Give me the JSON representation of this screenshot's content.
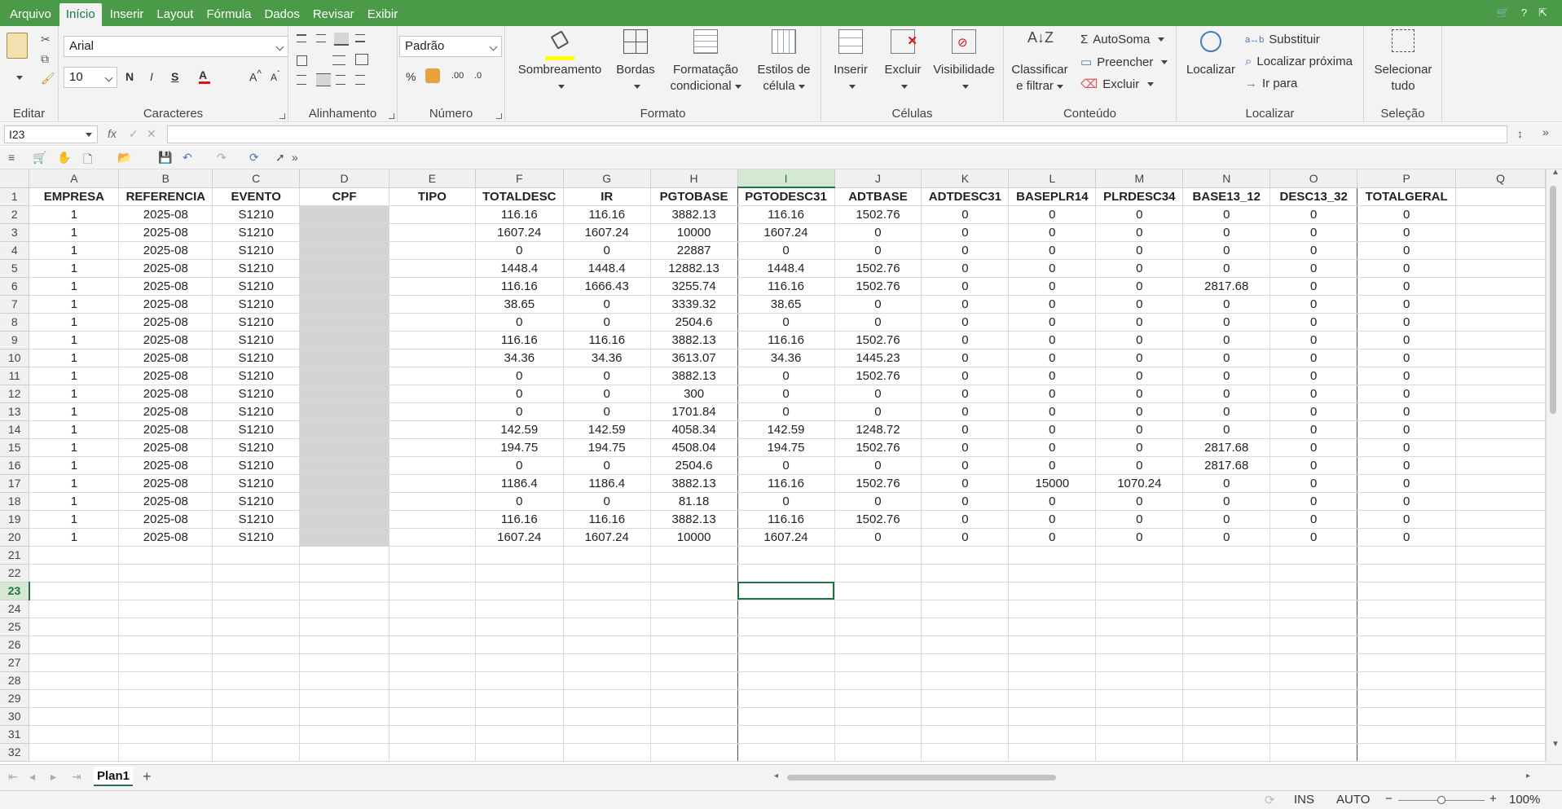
{
  "menu": {
    "tabs": [
      "Arquivo",
      "Início",
      "Inserir",
      "Layout",
      "Fórmula",
      "Dados",
      "Revisar",
      "Exibir"
    ],
    "active_tab": "Início",
    "right_icons": [
      "cart-icon",
      "help-icon",
      "restore-icon"
    ]
  },
  "ribbon": {
    "groups": {
      "editar": "Editar",
      "caracteres": "Caracteres",
      "alinhamento": "Alinhamento",
      "numero": "Número",
      "formato": "Formato",
      "celulas": "Células",
      "conteudo": "Conteúdo",
      "localizar": "Localizar",
      "selecao": "Seleção"
    },
    "font_name": "Arial",
    "font_size": "10",
    "number_format": "Padrão",
    "format_buttons": {
      "sombreamento": "Sombreamento",
      "bordas": "Bordas",
      "formatacao_1": "Formatação",
      "formatacao_2": "condicional",
      "estilos_1": "Estilos de",
      "estilos_2": "célula"
    },
    "cell_buttons": {
      "inserir": "Inserir",
      "excluir": "Excluir",
      "visibilidade": "Visibilidade"
    },
    "content": {
      "classificar_1": "Classificar",
      "classificar_2": "e filtrar",
      "autosoma": "AutoSoma",
      "preencher": "Preencher",
      "excluir": "Excluir"
    },
    "find": {
      "localizar": "Localizar",
      "substituir": "Substituir",
      "localizar_proxima": "Localizar próxima",
      "ir_para": "Ir para"
    },
    "select": {
      "line1": "Selecionar",
      "line2": "tudo"
    },
    "accent_shading": "#ffff00",
    "accent_font": "#e01010"
  },
  "formula_bar": {
    "name_box": "I23",
    "fx": "fx",
    "formula": ""
  },
  "sheet": {
    "columns": [
      "A",
      "B",
      "C",
      "D",
      "E",
      "F",
      "G",
      "H",
      "I",
      "J",
      "K",
      "L",
      "M",
      "N",
      "O",
      "P",
      "Q"
    ],
    "selected_column": "I",
    "selected_row": "23",
    "headers": [
      "EMPRESA",
      "REFERENCIA",
      "EVENTO",
      "CPF",
      "TIPO",
      "TOTALDESC",
      "IR",
      "PGTOBASE",
      "PGTODESC31",
      "ADTBASE",
      "ADTDESC31",
      "BASEPLR14",
      "PLRDESC34",
      "BASE13_12",
      "DESC13_32",
      "TOTALGERAL",
      ""
    ],
    "rows": [
      [
        "1",
        "2025-08",
        "S1210",
        "",
        "",
        "116.16",
        "116.16",
        "3882.13",
        "116.16",
        "1502.76",
        "0",
        "0",
        "0",
        "0",
        "0",
        "0",
        ""
      ],
      [
        "1",
        "2025-08",
        "S1210",
        "",
        "",
        "1607.24",
        "1607.24",
        "10000",
        "1607.24",
        "0",
        "0",
        "0",
        "0",
        "0",
        "0",
        "0",
        ""
      ],
      [
        "1",
        "2025-08",
        "S1210",
        "",
        "",
        "0",
        "0",
        "22887",
        "0",
        "0",
        "0",
        "0",
        "0",
        "0",
        "0",
        "0",
        ""
      ],
      [
        "1",
        "2025-08",
        "S1210",
        "",
        "",
        "1448.4",
        "1448.4",
        "12882.13",
        "1448.4",
        "1502.76",
        "0",
        "0",
        "0",
        "0",
        "0",
        "0",
        ""
      ],
      [
        "1",
        "2025-08",
        "S1210",
        "",
        "",
        "116.16",
        "1666.43",
        "3255.74",
        "116.16",
        "1502.76",
        "0",
        "0",
        "0",
        "2817.68",
        "0",
        "0",
        ""
      ],
      [
        "1",
        "2025-08",
        "S1210",
        "",
        "",
        "38.65",
        "0",
        "3339.32",
        "38.65",
        "0",
        "0",
        "0",
        "0",
        "0",
        "0",
        "0",
        ""
      ],
      [
        "1",
        "2025-08",
        "S1210",
        "",
        "",
        "0",
        "0",
        "2504.6",
        "0",
        "0",
        "0",
        "0",
        "0",
        "0",
        "0",
        "0",
        ""
      ],
      [
        "1",
        "2025-08",
        "S1210",
        "",
        "",
        "116.16",
        "116.16",
        "3882.13",
        "116.16",
        "1502.76",
        "0",
        "0",
        "0",
        "0",
        "0",
        "0",
        ""
      ],
      [
        "1",
        "2025-08",
        "S1210",
        "",
        "",
        "34.36",
        "34.36",
        "3613.07",
        "34.36",
        "1445.23",
        "0",
        "0",
        "0",
        "0",
        "0",
        "0",
        ""
      ],
      [
        "1",
        "2025-08",
        "S1210",
        "",
        "",
        "0",
        "0",
        "3882.13",
        "0",
        "1502.76",
        "0",
        "0",
        "0",
        "0",
        "0",
        "0",
        ""
      ],
      [
        "1",
        "2025-08",
        "S1210",
        "",
        "",
        "0",
        "0",
        "300",
        "0",
        "0",
        "0",
        "0",
        "0",
        "0",
        "0",
        "0",
        ""
      ],
      [
        "1",
        "2025-08",
        "S1210",
        "",
        "",
        "0",
        "0",
        "1701.84",
        "0",
        "0",
        "0",
        "0",
        "0",
        "0",
        "0",
        "0",
        ""
      ],
      [
        "1",
        "2025-08",
        "S1210",
        "",
        "",
        "142.59",
        "142.59",
        "4058.34",
        "142.59",
        "1248.72",
        "0",
        "0",
        "0",
        "0",
        "0",
        "0",
        ""
      ],
      [
        "1",
        "2025-08",
        "S1210",
        "",
        "",
        "194.75",
        "194.75",
        "4508.04",
        "194.75",
        "1502.76",
        "0",
        "0",
        "0",
        "2817.68",
        "0",
        "0",
        ""
      ],
      [
        "1",
        "2025-08",
        "S1210",
        "",
        "",
        "0",
        "0",
        "2504.6",
        "0",
        "0",
        "0",
        "0",
        "0",
        "2817.68",
        "0",
        "0",
        ""
      ],
      [
        "1",
        "2025-08",
        "S1210",
        "",
        "",
        "1186.4",
        "1186.4",
        "3882.13",
        "116.16",
        "1502.76",
        "0",
        "15000",
        "1070.24",
        "0",
        "0",
        "0",
        ""
      ],
      [
        "1",
        "2025-08",
        "S1210",
        "",
        "",
        "0",
        "0",
        "81.18",
        "0",
        "0",
        "0",
        "0",
        "0",
        "0",
        "0",
        "0",
        ""
      ],
      [
        "1",
        "2025-08",
        "S1210",
        "",
        "",
        "116.16",
        "116.16",
        "3882.13",
        "116.16",
        "1502.76",
        "0",
        "0",
        "0",
        "0",
        "0",
        "0",
        ""
      ],
      [
        "1",
        "2025-08",
        "S1210",
        "",
        "",
        "1607.24",
        "1607.24",
        "10000",
        "1607.24",
        "0",
        "0",
        "0",
        "0",
        "0",
        "0",
        "0",
        ""
      ]
    ],
    "total_rows": 32
  },
  "sheet_tabs": {
    "active": "Plan1",
    "add": "+"
  },
  "status": {
    "ins": "INS",
    "auto": "AUTO",
    "zoom": "100%"
  }
}
